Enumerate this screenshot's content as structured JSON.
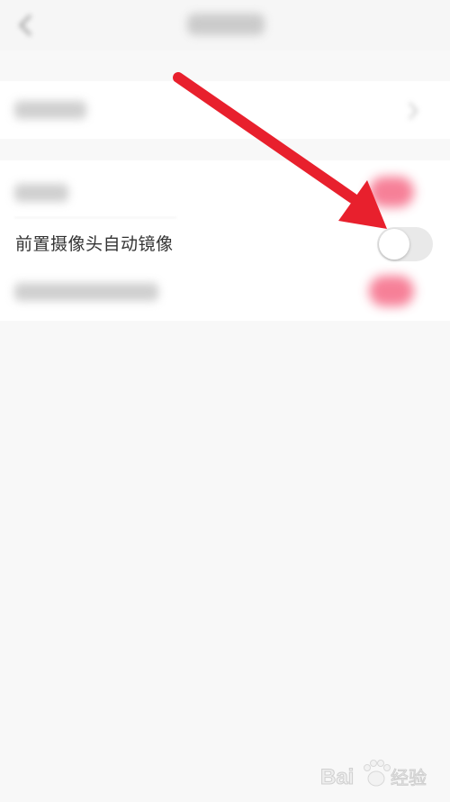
{
  "settings": {
    "front_camera_mirror": {
      "label": "前置摄像头自动镜像",
      "enabled": false
    }
  },
  "colors": {
    "accent": "#f56a86",
    "annotation_arrow": "#e8202d",
    "toggle_off": "#e9e9e9",
    "background": "#f8f8f8"
  },
  "icons": {
    "back": "back-arrow-icon",
    "chevron": "chevron-right-icon",
    "annotation": "red-arrow-annotation",
    "watermark": "baidu-jingyan-watermark"
  },
  "watermark": {
    "brand": "Bai",
    "suffix": "经验"
  }
}
